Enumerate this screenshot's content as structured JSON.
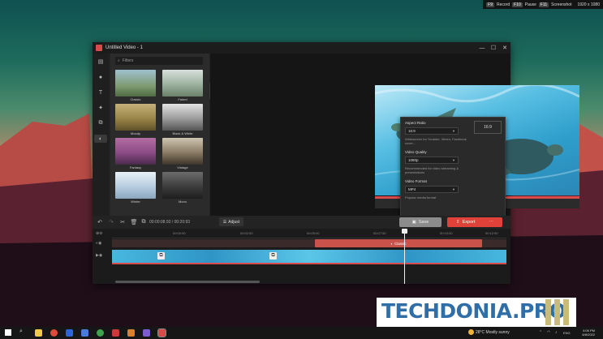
{
  "recorder": {
    "record_key": "F9",
    "record_label": "Record",
    "pause_key": "F10",
    "pause_label": "Pause",
    "screenshot_key": "F11",
    "screenshot_label": "Screenshot",
    "resolution": "1920 x 1080"
  },
  "window": {
    "title": "Untitled Video - 1",
    "minimize": "—",
    "maximize": "☐",
    "close": "✕"
  },
  "filters": {
    "search_placeholder": "Filters",
    "items": [
      {
        "label": "Classic"
      },
      {
        "label": "Faded"
      },
      {
        "label": "Moody"
      },
      {
        "label": "Black & White"
      },
      {
        "label": "Fantasy"
      },
      {
        "label": "Vintage"
      },
      {
        "label": "Winter"
      },
      {
        "label": "Mono"
      }
    ]
  },
  "player": {
    "help": "?",
    "prev": "⏮",
    "rewind": "⏪",
    "play": "▶",
    "forward": "⏩",
    "next": "⏭"
  },
  "export_panel": {
    "aspect_ratio_label": "Aspect Ratio",
    "aspect_ratio_value": "16:9",
    "aspect_ratio_desc": "Widescreen for Youtube, Vimeo, Facebook cover...",
    "aspect_ratio_box": "16:9",
    "quality_label": "Video Quality",
    "quality_value": "1080p",
    "quality_desc": "Recommended for video streaming & presentations",
    "format_label": "Video Format",
    "format_value": "MP4",
    "format_desc": "Popular media format"
  },
  "toolbar": {
    "time": "00:00:08.93 / 00:20:93",
    "adjust": "Adjust",
    "save": "Save",
    "export": "Export",
    "more": "⋯"
  },
  "timeline": {
    "ruler": [
      "00:00:00",
      "00:02:50",
      "00:05:00",
      "00:07:50",
      "00:10:00",
      "00:12:50"
    ],
    "filter_clip_label": "Classic"
  },
  "watermark": "TECHDONIA.PRO",
  "taskbar": {
    "weather": "28°C Mostly sunny",
    "time": "4:06 PM",
    "date": "8/8/2022",
    "lang": "ENG"
  },
  "colors": {
    "accent": "#e0423a",
    "clip": "#c9534b"
  }
}
